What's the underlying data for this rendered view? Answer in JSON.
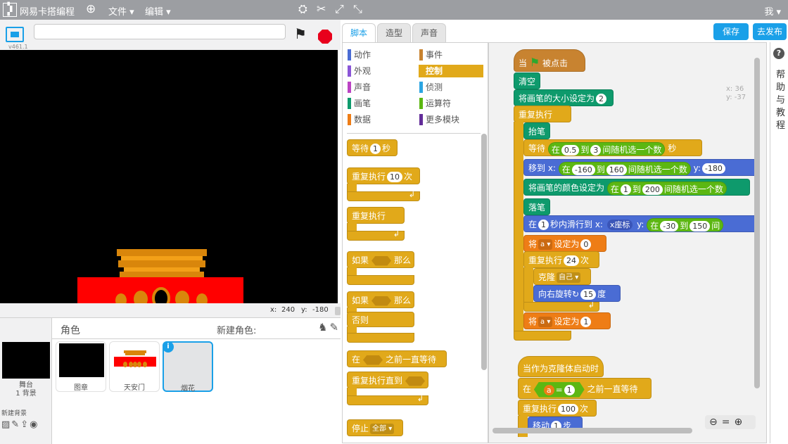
{
  "app": {
    "brand": "网易卡搭编程",
    "menu_file": "文件 ▾",
    "menu_edit": "编辑 ▾",
    "user": "我 ▾"
  },
  "stage_bar": {
    "version": "v461.1",
    "title_value": ""
  },
  "stage_info": {
    "x_label": "x:",
    "x_value": "240",
    "y_label": "y:",
    "y_value": "-180"
  },
  "sprites_panel": {
    "header_label": "角色",
    "new_sprite_label": "新建角色:",
    "stage_name": "舞台",
    "stage_bg_count": "1 背景",
    "new_backdrop_label": "新建背景",
    "sprites": [
      {
        "name": "图章"
      },
      {
        "name": "天安门"
      },
      {
        "name": "烟花"
      }
    ]
  },
  "tabs": [
    "脚本",
    "造型",
    "声音"
  ],
  "buttons": {
    "save": "保存",
    "publish": "去发布"
  },
  "categories": [
    {
      "label": "动作",
      "color": "#4a6cd4"
    },
    {
      "label": "事件",
      "color": "#c88330"
    },
    {
      "label": "外观",
      "color": "#8a55d7"
    },
    {
      "label": "控制",
      "color": "#e1a91a"
    },
    {
      "label": "声音",
      "color": "#bb42c3"
    },
    {
      "label": "侦测",
      "color": "#2ca5e2"
    },
    {
      "label": "画笔",
      "color": "#0e9a6c"
    },
    {
      "label": "运算符",
      "color": "#5cb712"
    },
    {
      "label": "数据",
      "color": "#ee7d16"
    },
    {
      "label": "更多模块",
      "color": "#632d99"
    }
  ],
  "palette_blocks": {
    "wait_label": "等待",
    "wait_value": "1",
    "wait_unit": "秒",
    "repeat_label": "重复执行",
    "repeat_value": "10",
    "repeat_unit": "次",
    "forever_label": "重复执行",
    "if_label": "如果",
    "if_then": "那么",
    "ifelse_label": "如果",
    "ifelse_then": "那么",
    "ifelse_else": "否则",
    "waituntil_pre": "在",
    "waituntil_post": "之前一直等待",
    "repeatuntil_label": "重复执行直到",
    "stop_label": "停止",
    "stop_option": "全部 ▾"
  },
  "script_xy": {
    "x_label": "x:",
    "x_value": "36",
    "y_label": "y:",
    "y_value": "-37"
  },
  "script1": {
    "hat_when": "当",
    "hat_clicked": "被点击",
    "clear": "清空",
    "pen_size_label": "将画笔的大小设定为",
    "pen_size_value": "2",
    "forever": "重复执行",
    "pen_up": "抬笔",
    "wait_label": "等待",
    "wait_in": "在",
    "wait_from": "0.5",
    "wait_to_word": "到",
    "wait_to": "3",
    "wait_random": "间随机选一个数",
    "wait_unit": "秒",
    "goto_label": "移到 x:",
    "goto_in": "在",
    "goto_from": "-160",
    "goto_to_word": "到",
    "goto_to": "160",
    "goto_random": "间随机选一个数",
    "goto_y_label": "y:",
    "goto_y": "-180",
    "color_label": "将画笔的颜色设定为",
    "color_in": "在",
    "color_from": "1",
    "color_to_word": "到",
    "color_to": "200",
    "color_random": "间随机选一个数",
    "pen_down": "落笔",
    "glide_in": "在",
    "glide_secs": "1",
    "glide_label": "秒内滑行到 x:",
    "glide_xpos": "x座标",
    "glide_y_label": "y:",
    "glide_y_in": "在",
    "glide_y_from": "-30",
    "glide_y_to_word": "到",
    "glide_y_to": "150",
    "glide_y_random": "间",
    "set1_label": "将",
    "set1_var": "a ▾",
    "set1_mid": "设定为",
    "set1_value": "0",
    "repeat_label": "重复执行",
    "repeat_value": "24",
    "repeat_unit": "次",
    "clone_label": "克隆",
    "clone_target": "自己 ▾",
    "turn_label": "向右旋转",
    "turn_icon": "↻",
    "turn_value": "15",
    "turn_unit": "度",
    "set2_label": "将",
    "set2_var": "a ▾",
    "set2_mid": "设定为",
    "set2_value": "1"
  },
  "script2": {
    "hat": "当作为克隆体启动时",
    "wait_pre": "在",
    "wait_var": "a",
    "wait_eq": "=",
    "wait_val": "1",
    "wait_post": "之前一直等待",
    "repeat_label": "重复执行",
    "repeat_value": "100",
    "repeat_unit": "次",
    "move_label": "移动",
    "move_value": "1",
    "move_unit": "步"
  },
  "help": {
    "q": "?",
    "text": "帮助与教程"
  }
}
